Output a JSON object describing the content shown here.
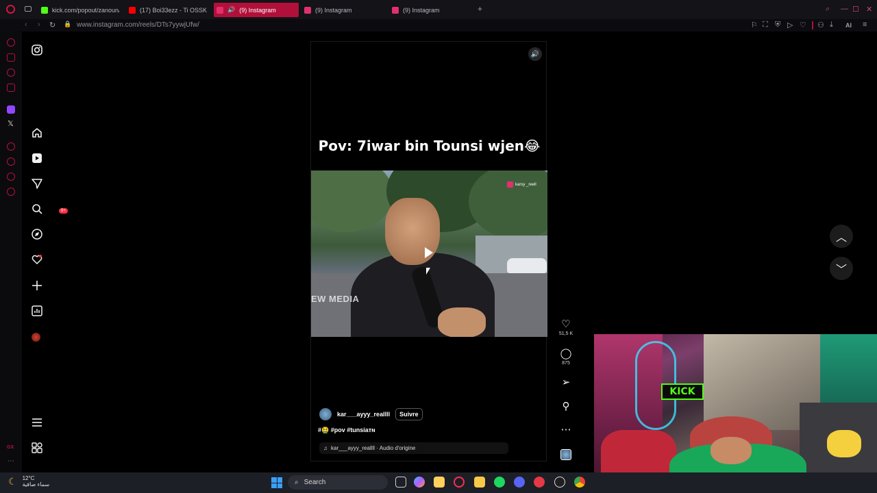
{
  "browser": {
    "tabs": [
      {
        "label": "kick.com/popout/zanoun/",
        "fav_color": "#53fc18",
        "active": false
      },
      {
        "label": "(17) Boi33ezz - Ti OSSKE",
        "fav_color": "#ff0000",
        "active": false
      },
      {
        "label": "(9) Instagram",
        "fav_color": "#e1306c",
        "active": true
      },
      {
        "label": "(9) Instagram",
        "fav_color": "#e1306c",
        "active": false
      },
      {
        "label": "(9) Instagram",
        "fav_color": "#e1306c",
        "active": false
      }
    ],
    "new_tab_label": "+",
    "url": "www.instagram.com/reels/DTs7yywjUfw/",
    "toolbar_ai_label": "AI"
  },
  "reel": {
    "caption_text": "Pov: 7iwar bin Tounsi wjen😂",
    "video_watermark": "EW MEDIA",
    "video_tag": "karsy _reell",
    "author": "kar___ayyy_reallll",
    "follow_label": "Suivre",
    "hashtags": "#🤮 #pov #tunsiaᴛɴ",
    "audio_label": "kar___ayyy_reallll · Audio d'origine"
  },
  "actions": {
    "likes": "51,5 K",
    "comments": "875"
  },
  "nav": {
    "notifications_badge": "9+"
  },
  "taskbar": {
    "temperature": "12°C",
    "weather_desc": "سماء صافية",
    "search_placeholder": "Search"
  },
  "colors": {
    "accent": "#b1103a",
    "instagram_badge": "#ff3040"
  }
}
